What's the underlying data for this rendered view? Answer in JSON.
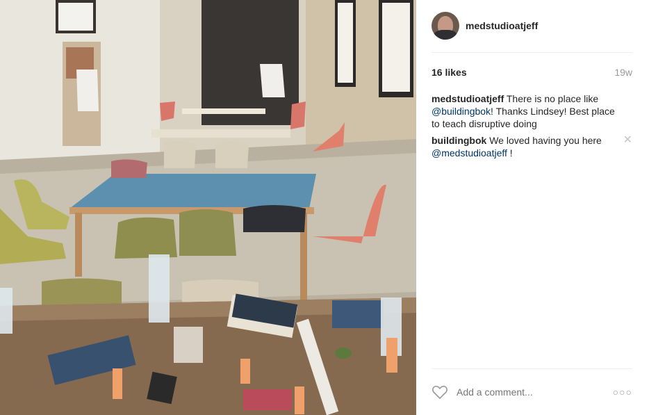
{
  "post": {
    "username": "medstudioatjeff",
    "likes": "16 likes",
    "age": "19w"
  },
  "comments": [
    {
      "user": "medstudioatjeff",
      "parts": [
        {
          "text": " There is no place like ",
          "mention": false
        },
        {
          "text": "@buildingbok",
          "mention": true
        },
        {
          "text": "! Thanks Lindsey! Best place to teach disruptive doing",
          "mention": false
        }
      ]
    },
    {
      "user": "buildingbok",
      "parts": [
        {
          "text": " We loved having you here ",
          "mention": false
        },
        {
          "text": "@medstudioatjeff",
          "mention": true
        },
        {
          "text": " !",
          "mention": false
        }
      ]
    }
  ],
  "comment_box": {
    "placeholder": "Add a comment..."
  },
  "icons": {
    "like": "heart-icon",
    "more": "more-options-icon",
    "delete": "close-icon"
  },
  "colors": {
    "mention": "#003569",
    "muted": "#999999",
    "text": "#262626"
  }
}
